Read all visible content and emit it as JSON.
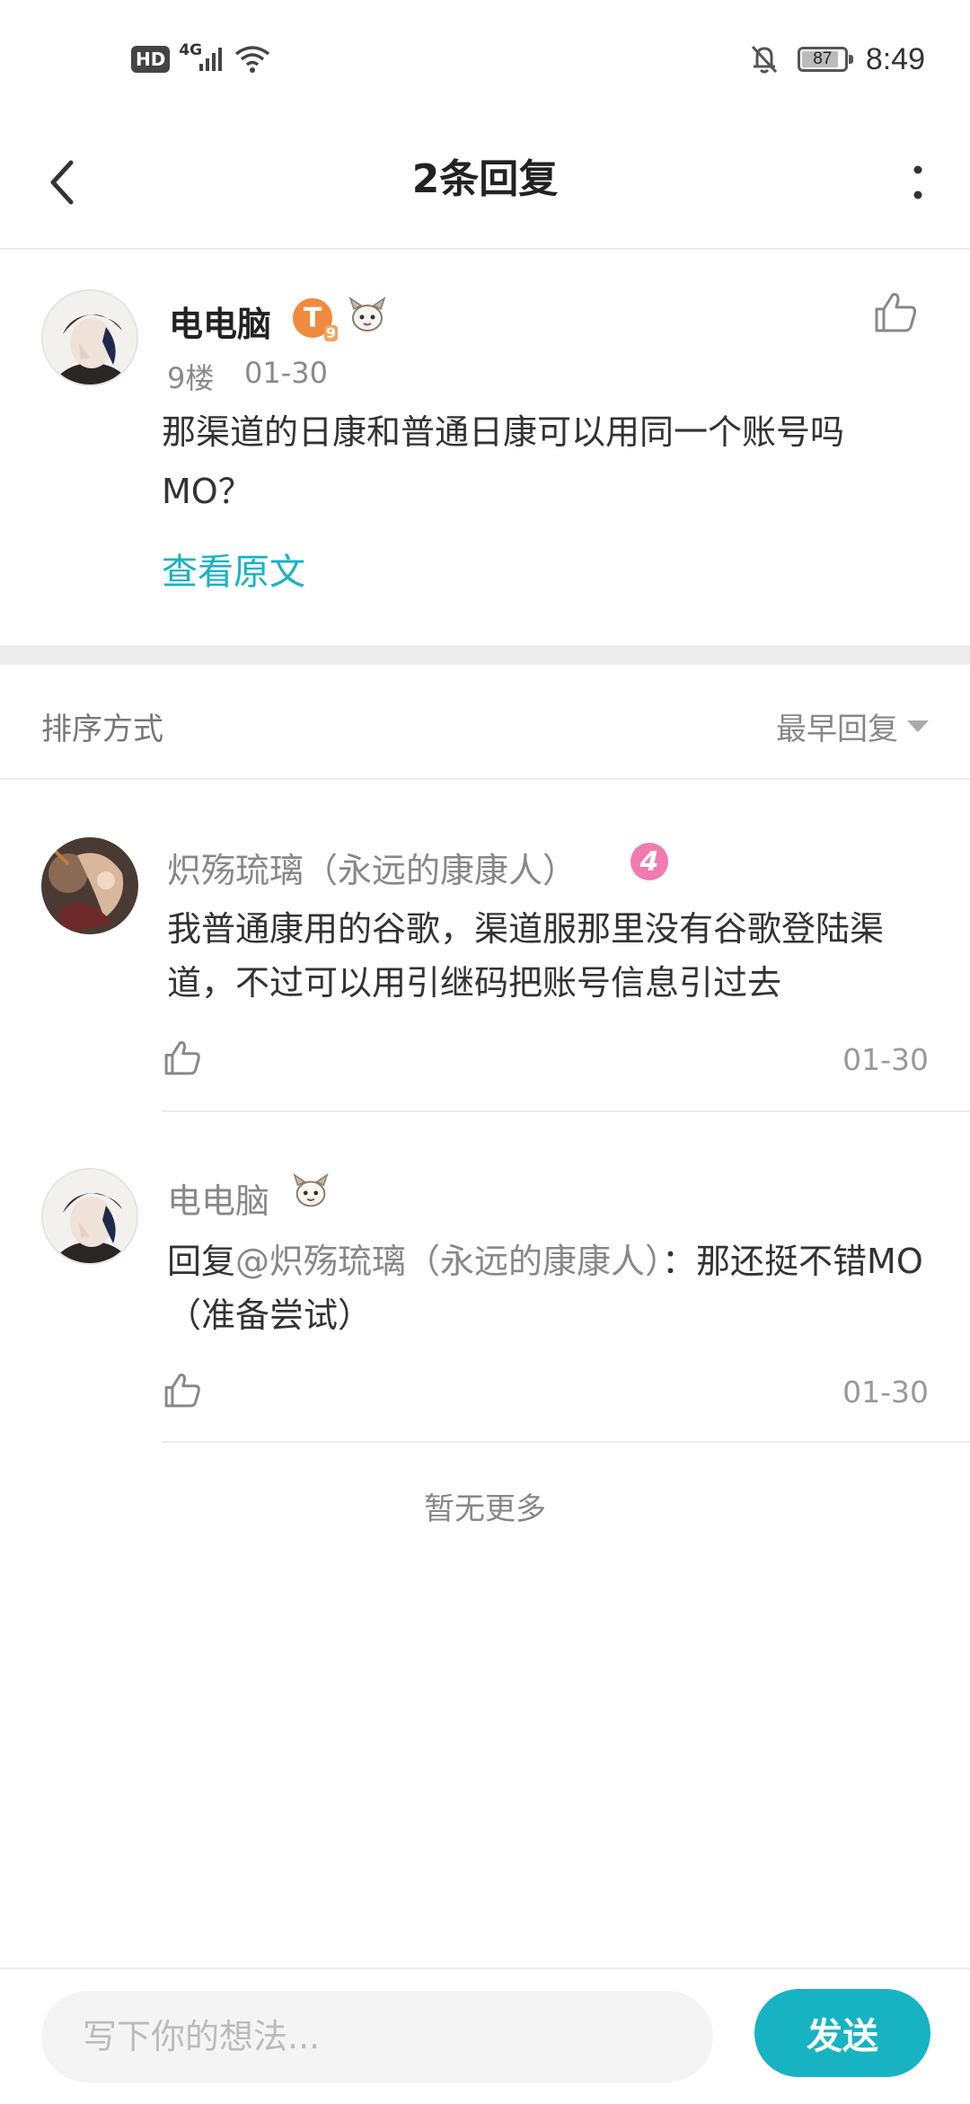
{
  "status_bar": {
    "hd": "HD",
    "network": "4G",
    "battery": "87",
    "battery_level": 0.87,
    "time": "8:49",
    "icons": [
      "signal-icon",
      "wifi-icon",
      "mute-bell-icon",
      "battery-icon"
    ]
  },
  "nav": {
    "title": "2条回复",
    "back_icon": "chevron-left-icon",
    "more_icon": "more-vertical-icon"
  },
  "post": {
    "author": "电电脑",
    "level_badge": "T",
    "level_sub": "9",
    "floor": "9楼",
    "date": "01-30",
    "content": "那渠道的日康和普通日康可以用同一个账号吗MO？",
    "view_original": "查看原文"
  },
  "sort": {
    "label": "排序方式",
    "value": "最早回复"
  },
  "replies": [
    {
      "author": "炽殇琉璃（永远的康康人）",
      "badge": "4",
      "content": "我普通康用的谷歌，渠道服那里没有谷歌登陆渠道，不过可以用引继码把账号信息引过去",
      "date": "01-30"
    },
    {
      "author": "电电脑",
      "reply_prefix": "回复",
      "mention": "@炽殇琉璃（永远的康康人）",
      "content": "：那还挺不错MO（准备尝试）",
      "date": "01-30"
    }
  ],
  "footer_text": "暂无更多",
  "composer": {
    "placeholder": "写下你的想法...",
    "send_label": "发送"
  },
  "colors": {
    "accent": "#17b3c3",
    "level_badge": "#f08a3c",
    "pink_badge": "#f17bb0"
  }
}
